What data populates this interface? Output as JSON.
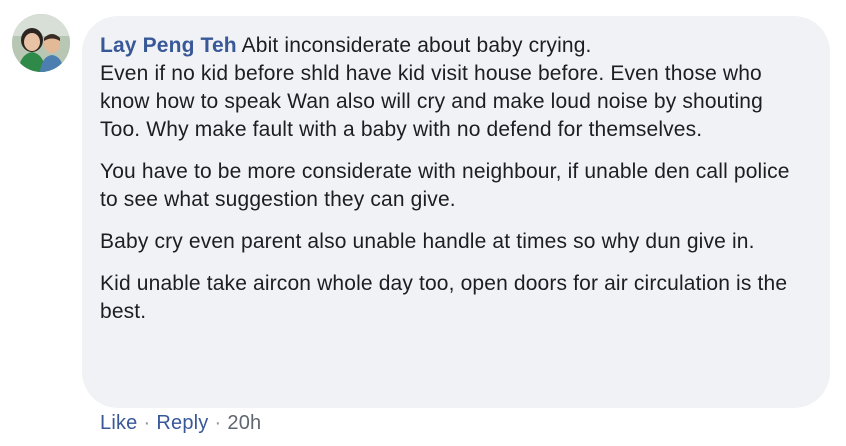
{
  "comment": {
    "author": "Lay Peng Teh",
    "paragraphs": [
      "Abit inconsiderate about baby crying.\nEven if no kid before shld have kid visit house before. Even those who know how to speak Wan also will cry and make loud noise by shouting Too. Why make fault with a baby with no defend for themselves.",
      "You have to be more considerate with neighbour, if unable den call police to see what suggestion they can give.",
      "Baby cry even parent also unable handle at times so why dun give in.",
      "Kid unable take aircon whole day too, open doors for air circulation is the best."
    ]
  },
  "actions": {
    "like_label": "Like",
    "separator": "·",
    "reply_label": "Reply",
    "timestamp": "20h"
  },
  "colors": {
    "author_link": "#385898",
    "bubble_bg": "#f0f2f5",
    "meta_text": "#606770"
  }
}
